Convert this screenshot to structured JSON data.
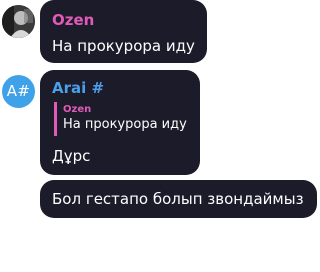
{
  "messages": [
    {
      "author": "Ozen",
      "author_color": "#e05bb8",
      "text": "На прокурора иду"
    },
    {
      "author": "Arai #",
      "author_color": "#4a9fe8",
      "avatar_initials": "A#",
      "reply": {
        "author": "Ozen",
        "author_color": "#e05bb8",
        "text": "На прокурора иду"
      },
      "text": "Дұрс"
    },
    {
      "text": "Бол гестапо болып звондаймыз"
    }
  ],
  "colors": {
    "bubble": "#1c1b2a",
    "quote_bar": "#e05bb8",
    "avatar_bg": "#3fa2e8"
  }
}
